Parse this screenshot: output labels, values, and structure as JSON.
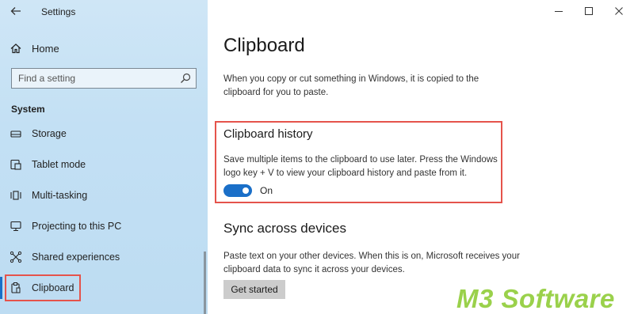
{
  "window": {
    "title": "Settings",
    "controls": {
      "minimize": "—",
      "maximize": "☐",
      "close": "✕"
    }
  },
  "sidebar": {
    "home_label": "Home",
    "search_placeholder": "Find a setting",
    "section": "System",
    "items": [
      {
        "label": "Storage",
        "icon": "storage-icon"
      },
      {
        "label": "Tablet mode",
        "icon": "tablet-mode-icon"
      },
      {
        "label": "Multi-tasking",
        "icon": "multitasking-icon"
      },
      {
        "label": "Projecting to this PC",
        "icon": "projecting-icon"
      },
      {
        "label": "Shared experiences",
        "icon": "shared-experiences-icon"
      },
      {
        "label": "Clipboard",
        "icon": "clipboard-icon"
      }
    ],
    "active_item": "Clipboard"
  },
  "main": {
    "title": "Clipboard",
    "intro": "When you copy or cut something in Windows, it is copied to the clipboard for you to paste.",
    "history": {
      "title": "Clipboard history",
      "description": "Save multiple items to the clipboard to use later. Press the Windows logo key + V to view your clipboard history and paste from it.",
      "toggle_state": "On"
    },
    "sync": {
      "title": "Sync across devices",
      "description": "Paste text on your other devices. When this is on, Microsoft receives your clipboard data to sync it across your devices.",
      "button_label": "Get started"
    }
  },
  "watermark": {
    "prefix": "M3",
    "suffix": " Software"
  },
  "colors": {
    "accent": "#1a6fc8",
    "highlight": "#e5534b",
    "sidebar_bg": "#c3e0f4",
    "watermark": "#9ad14b"
  }
}
